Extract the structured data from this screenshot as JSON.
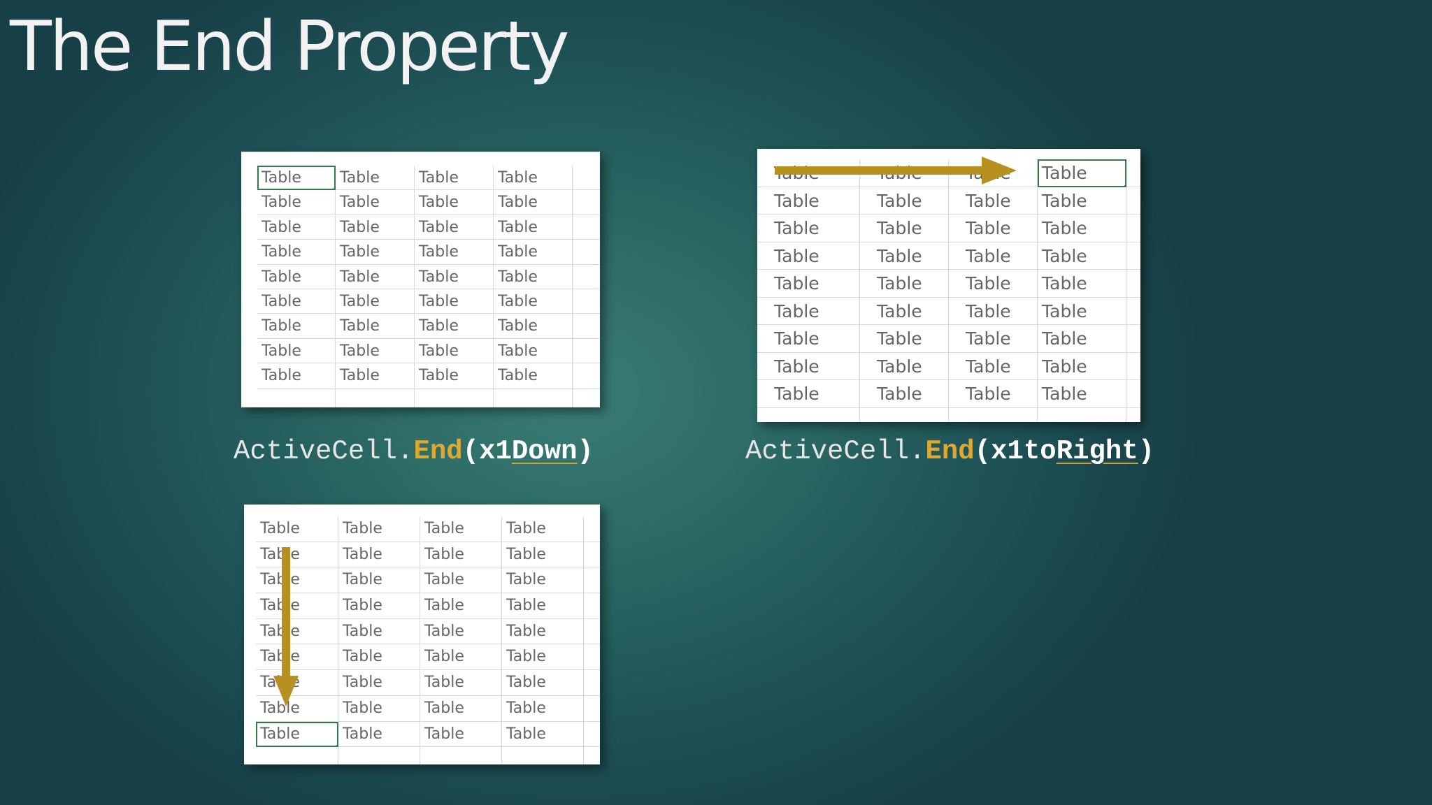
{
  "slide": {
    "title": "The End Property"
  },
  "examples": [
    {
      "id": "down",
      "code": {
        "object": "ActiveCell",
        "dot": ".",
        "method": "End",
        "open_paren": "(",
        "const_prefix": "x1",
        "const_name": "Down",
        "close_paren": ")"
      }
    },
    {
      "id": "right",
      "code": {
        "object": "ActiveCell",
        "dot": ".",
        "method": "End",
        "open_paren": "(",
        "const_prefix": "x1to",
        "const_name": "Right",
        "close_paren": ")"
      }
    }
  ],
  "sheets": {
    "down_top": {
      "cell_text": "Table",
      "rows": 9,
      "cols": 4,
      "active_cell": {
        "row": 1,
        "col": 1
      }
    },
    "right": {
      "cell_text": "Table",
      "rows": 9,
      "cols": 4,
      "active_cell": {
        "row": 1,
        "col": 4
      },
      "arrow_direction": "right"
    },
    "down_bottom": {
      "cell_text": "Table",
      "rows": 9,
      "cols": 4,
      "active_cell": {
        "row": 9,
        "col": 1
      },
      "arrow_direction": "down"
    }
  },
  "colors": {
    "arrow": "#b8901f",
    "keyword": "#e0a82e",
    "active_cell_border": "#2e7d4a",
    "cell_text": "#666666"
  }
}
